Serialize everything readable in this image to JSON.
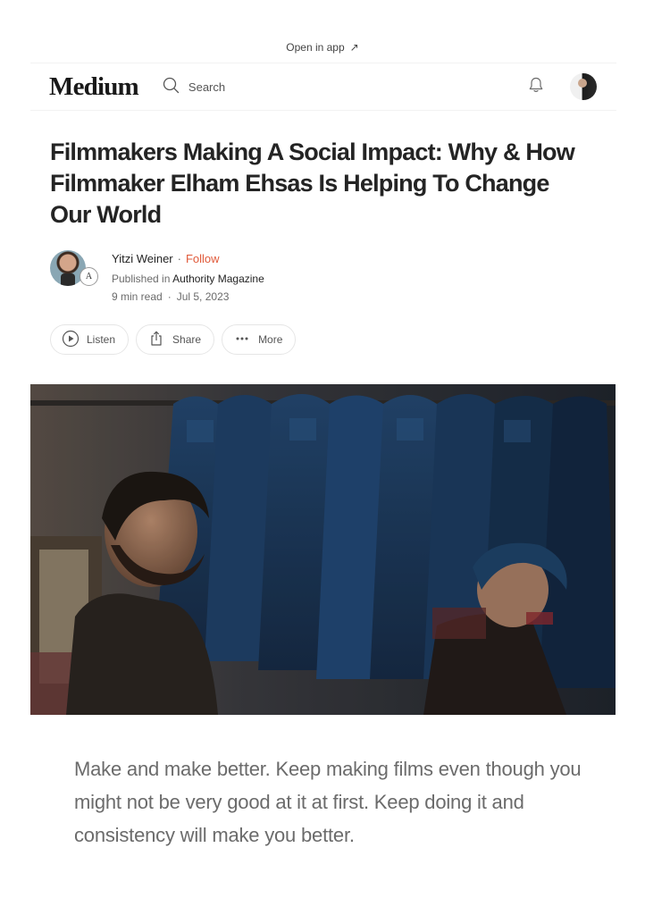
{
  "banner": {
    "open_in_app": "Open in app",
    "arrow_icon": "arrow-up-right-icon"
  },
  "nav": {
    "logo": "Medium",
    "search_label": "Search",
    "search_icon": "search-icon",
    "bell_icon": "bell-icon",
    "avatar_icon": "user-avatar"
  },
  "article": {
    "title": "Filmmakers Making A Social Impact: Why & How Filmmaker Elham Ehsas Is Helping To Change Our World",
    "author": {
      "name": "Yitzi Weiner",
      "separator": "·",
      "follow": "Follow",
      "published_prefix": "Published in",
      "publication": "Authority Magazine",
      "read_time": "9 min read",
      "meta_separator": "·",
      "date": "Jul 5, 2023"
    },
    "actions": {
      "listen": "Listen",
      "share": "Share",
      "more": "More"
    },
    "quote": "Make and make better. Keep making films even though you might not be very good at it at first. Keep doing it and consistency will make you better."
  },
  "colors": {
    "follow_accent": "#e05a3a",
    "text_primary": "#242424",
    "text_muted": "#6b6b6b"
  }
}
